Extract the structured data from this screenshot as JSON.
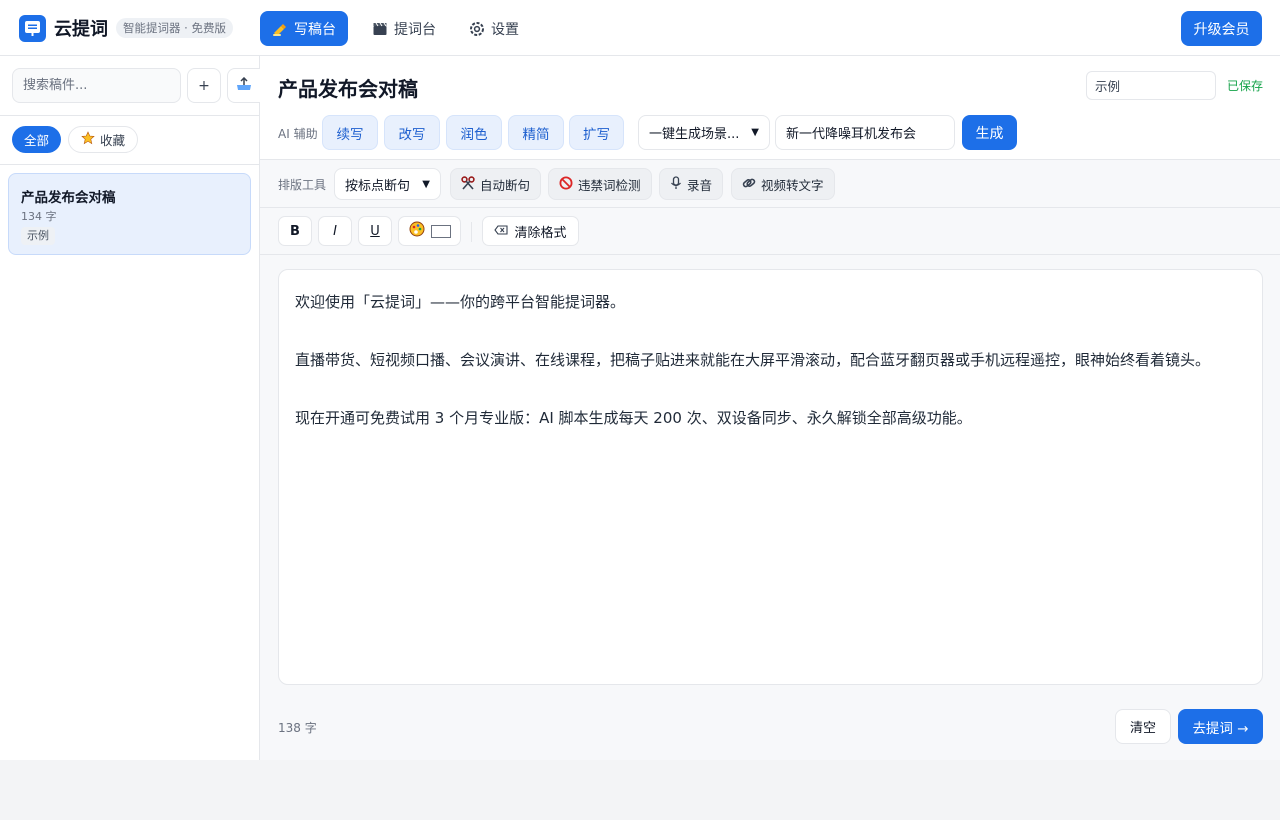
{
  "app": {
    "name": "云提词",
    "tagline": "智能提词器 · 免费版",
    "upgrade_label": "升级会员"
  },
  "nav": {
    "items": [
      {
        "label": "写稿台",
        "icon": "writing-hand-icon",
        "active": true
      },
      {
        "label": "提词台",
        "icon": "clapperboard-icon",
        "active": false
      },
      {
        "label": "设置",
        "icon": "gear-icon",
        "active": false
      }
    ]
  },
  "sidebar": {
    "search_placeholder": "搜索稿件...",
    "add_label": "+",
    "import_icon": "tray-upload-icon",
    "filters": [
      {
        "label": "全部",
        "active": true
      },
      {
        "label": "收藏",
        "icon": "star-icon",
        "active": false
      }
    ],
    "docs": [
      {
        "title": "产品发布会对稿",
        "count": "134 字",
        "tag": "示例",
        "selected": true
      }
    ]
  },
  "editor": {
    "title": "产品发布会对稿",
    "tag_value": "示例",
    "saved_status": "已保存",
    "ai_label": "AI 辅助",
    "ai_actions": [
      "续写",
      "改写",
      "润色",
      "精简",
      "扩写"
    ],
    "scene_select": "一键生成场景...",
    "topic_value": "新一代降噪耳机发布会",
    "generate_label": "生成",
    "layout_label": "排版工具",
    "break_mode": "按标点断句",
    "tools": [
      {
        "label": "自动断句",
        "icon": "scissors-icon"
      },
      {
        "label": "违禁词检测",
        "icon": "prohibited-icon"
      },
      {
        "label": "录音",
        "icon": "microphone-icon"
      },
      {
        "label": "视频转文字",
        "icon": "link-icon"
      }
    ],
    "format": {
      "bold": "B",
      "italic": "I",
      "underline": "U",
      "clear_label": "清除格式"
    },
    "paragraphs": [
      "欢迎使用「云提词」——你的跨平台智能提词器。",
      "直播带货、短视频口播、会议演讲、在线课程，把稿子贴进来就能在大屏平滑滚动，配合蓝牙翻页器或手机远程遥控，眼神始终看着镜头。",
      "现在开通可免费试用 3 个月专业版：AI 脚本生成每天 200 次、双设备同步、永久解锁全部高级功能。"
    ],
    "char_count": "138 字",
    "clear_label": "清空",
    "go_label": "去提词 →"
  },
  "colors": {
    "accent": "#1d6fe8",
    "saved": "#16a34a"
  }
}
